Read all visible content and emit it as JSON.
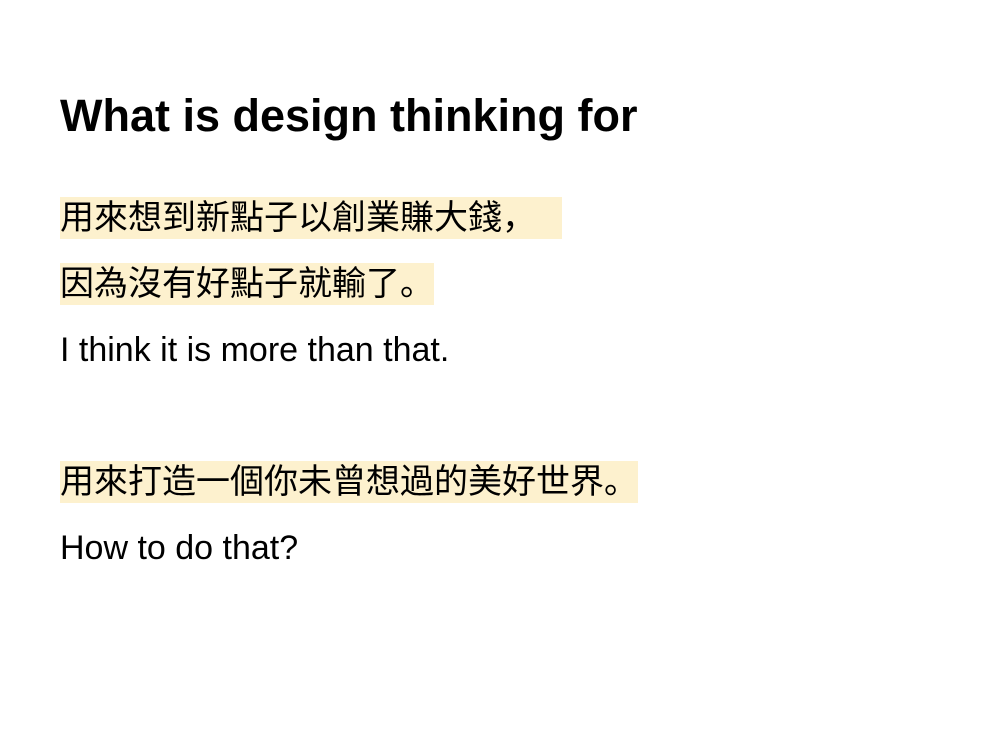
{
  "slide": {
    "title": "What is design thinking for",
    "lines": [
      {
        "text": "用來想到新點子以創業賺大錢，",
        "highlighted": true
      },
      {
        "text": "因為沒有好點子就輸了。",
        "highlighted": true
      },
      {
        "text": "I think it is more than that.",
        "highlighted": false
      },
      {
        "text": "用來打造一個你未曾想過的美好世界。",
        "highlighted": true
      },
      {
        "text": "How to do that?",
        "highlighted": false
      }
    ],
    "highlight_color": "#fdf1ce"
  }
}
